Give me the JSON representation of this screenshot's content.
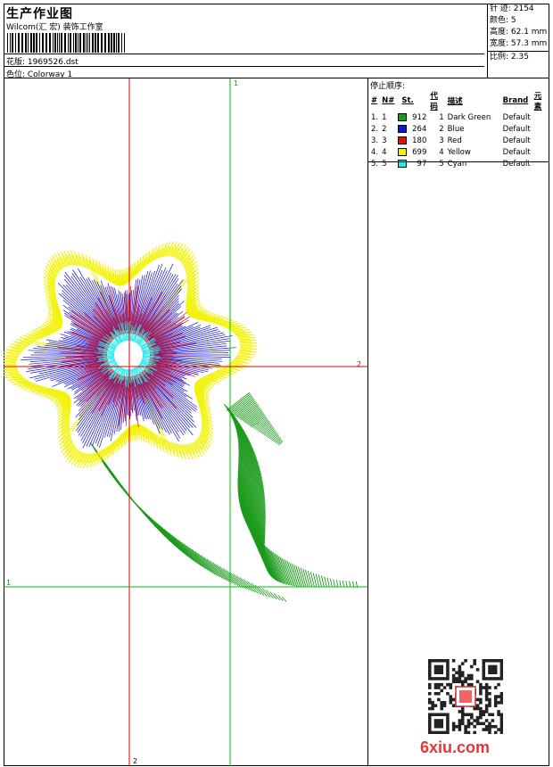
{
  "header": {
    "title": "生产作业图",
    "company": "Wilcom(汇 宏) 装饰工作室",
    "pattern_file": "花版: 1969526.dst",
    "colorway": "色位: Colorway 1"
  },
  "stats": {
    "stitches": "针 迹: 2154",
    "colors": "颜色: 5",
    "height": "高度: 62.1 mm",
    "width": "宽度: 57.3 mm",
    "scale": "比例: 2.35"
  },
  "stop_sequence": {
    "title": "停止顺序:",
    "headers": [
      "#",
      "N#",
      "St.",
      "代码",
      "描述",
      "Brand",
      "元素"
    ],
    "rows": [
      {
        "num": "1.",
        "n": "1",
        "color": "#1a9a1a",
        "st": "912",
        "code": "1",
        "desc": "Dark Green",
        "brand": "Default"
      },
      {
        "num": "2.",
        "n": "2",
        "color": "#1515d8",
        "st": "264",
        "code": "2",
        "desc": "Blue",
        "brand": "Default"
      },
      {
        "num": "3.",
        "n": "3",
        "color": "#e01010",
        "st": "180",
        "code": "3",
        "desc": "Red",
        "brand": "Default"
      },
      {
        "num": "4.",
        "n": "4",
        "color": "#f2f200",
        "st": "699",
        "code": "4",
        "desc": "Yellow",
        "brand": "Default"
      },
      {
        "num": "5.",
        "n": "5",
        "color": "#22e8f0",
        "st": "97",
        "code": "5",
        "desc": "Cyan",
        "brand": "Default"
      }
    ]
  },
  "guides": {
    "v_red_label": "2",
    "v_green_label": "1",
    "h_red_label": "2",
    "h_green_label": "1"
  },
  "watermark": "6xiu.com",
  "colors": {
    "guide_red": "#e00000",
    "guide_green": "#00c000",
    "green": "#1a9a1a",
    "blue": "#1515d8",
    "red": "#e01010",
    "yellow": "#f2f200",
    "cyan": "#22e8f0"
  }
}
